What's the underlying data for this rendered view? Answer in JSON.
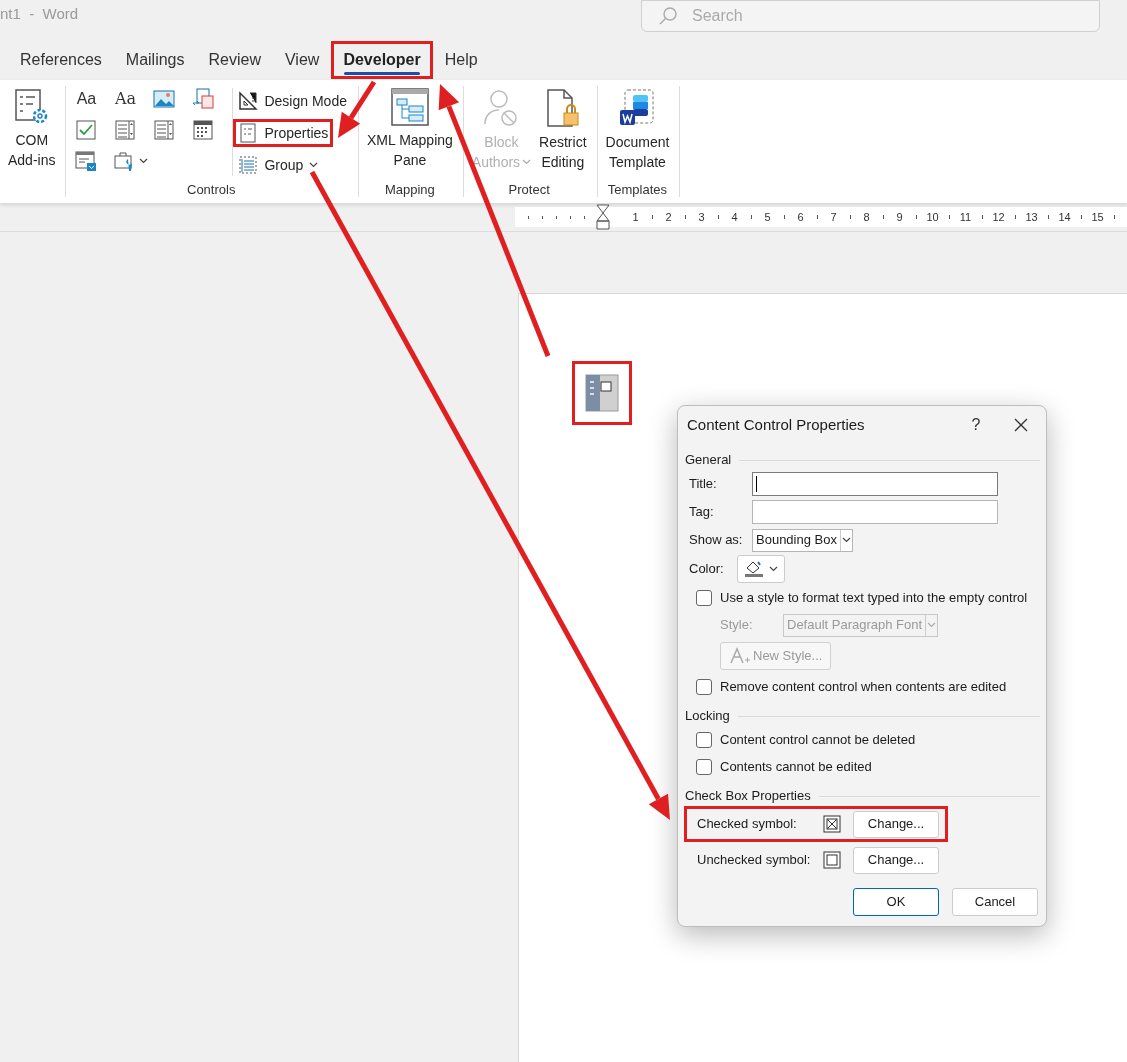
{
  "window": {
    "title": "nt1  -  Word"
  },
  "search": {
    "placeholder": "Search"
  },
  "tabs": [
    {
      "label": "References",
      "selected": false,
      "highlighted": false
    },
    {
      "label": "Mailings",
      "selected": false,
      "highlighted": false
    },
    {
      "label": "Review",
      "selected": false,
      "highlighted": false
    },
    {
      "label": "View",
      "selected": false,
      "highlighted": false
    },
    {
      "label": "Developer",
      "selected": true,
      "highlighted": true
    },
    {
      "label": "Help",
      "selected": false,
      "highlighted": false
    }
  ],
  "ribbon": {
    "groups": [
      {
        "kind": "large",
        "buttons": [
          {
            "lines": [
              "COM",
              "Add-ins"
            ],
            "disabled": false,
            "has_menu": false
          }
        ]
      },
      {
        "kind": "controls",
        "label": "Controls",
        "glyph_buttons": [
          "Aa",
          "Aa"
        ],
        "commands": [
          {
            "label": "Design Mode",
            "highlighted": false,
            "has_menu": false
          },
          {
            "label": "Properties",
            "highlighted": true,
            "has_menu": false
          },
          {
            "label": "Group",
            "highlighted": false,
            "has_menu": true
          }
        ]
      },
      {
        "kind": "large",
        "label": "Mapping",
        "buttons": [
          {
            "lines": [
              "XML Mapping",
              "Pane"
            ],
            "disabled": false,
            "has_menu": false
          }
        ]
      },
      {
        "kind": "large",
        "label": "Protect",
        "buttons": [
          {
            "lines": [
              "Block",
              "Authors"
            ],
            "disabled": true,
            "has_menu": true
          },
          {
            "lines": [
              "Restrict",
              "Editing"
            ],
            "disabled": false,
            "has_menu": false
          }
        ]
      },
      {
        "kind": "large",
        "label": "Templates",
        "buttons": [
          {
            "lines": [
              "Document",
              "Template"
            ],
            "disabled": false,
            "has_menu": false
          }
        ]
      }
    ]
  },
  "ruler": {
    "numbers": [
      "1",
      "2",
      "3",
      "4",
      "5",
      "6",
      "7",
      "8",
      "9",
      "10",
      "11",
      "12",
      "13",
      "14",
      "15"
    ]
  },
  "page": {
    "content_control": {
      "highlighted": true
    }
  },
  "dialog": {
    "title": "Content Control Properties",
    "help": "?",
    "sections": [
      {
        "label": "General",
        "items": [
          {
            "kind": "text",
            "label": "Title:",
            "focused": true
          },
          {
            "kind": "text",
            "label": "Tag:",
            "focused": false
          },
          {
            "kind": "dropdown",
            "label": "Show as:",
            "value": "Bounding Box",
            "disabled": false
          },
          {
            "kind": "color",
            "label": "Color:"
          },
          {
            "kind": "checkbox",
            "label": "Use a style to format text typed into the empty control",
            "checked": false,
            "children": [
              {
                "kind": "dropdown",
                "label": "Style:",
                "value": "Default Paragraph Font",
                "disabled": true
              },
              {
                "kind": "button",
                "label": "New Style...",
                "disabled": true
              }
            ]
          },
          {
            "kind": "checkbox",
            "label": "Remove content control when contents are edited",
            "checked": false
          }
        ]
      },
      {
        "label": "Locking",
        "items": [
          {
            "kind": "checkbox",
            "label": "Content control cannot be deleted",
            "checked": false
          },
          {
            "kind": "checkbox",
            "label": "Contents cannot be edited",
            "checked": false
          }
        ]
      },
      {
        "label": "Check Box Properties",
        "items": [
          {
            "kind": "symbol",
            "label": "Checked symbol:",
            "checked": true,
            "button": "Change...",
            "highlighted": true
          },
          {
            "kind": "symbol",
            "label": "Unchecked symbol:",
            "checked": false,
            "button": "Change...",
            "highlighted": false
          }
        ]
      }
    ],
    "buttons": [
      {
        "label": "OK",
        "default": true
      },
      {
        "label": "Cancel",
        "default": false
      }
    ]
  }
}
